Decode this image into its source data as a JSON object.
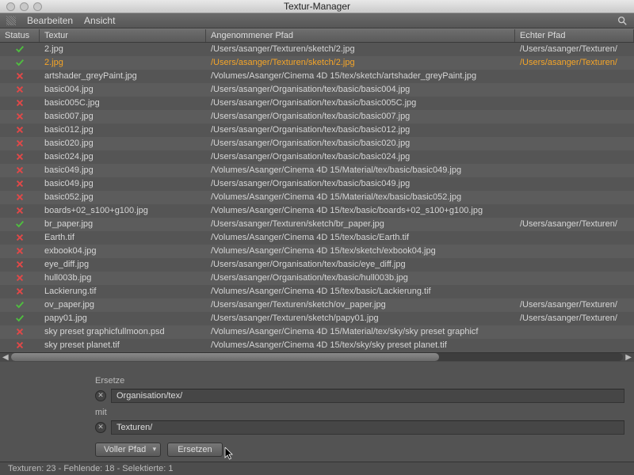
{
  "window": {
    "title": "Textur-Manager"
  },
  "menubar": {
    "edit": "Bearbeiten",
    "view": "Ansicht"
  },
  "columns": {
    "status": "Status",
    "texture": "Textur",
    "assumed": "Angenommener Pfad",
    "real": "Echter Pfad"
  },
  "rows": [
    {
      "status": "ok",
      "texture": "2.jpg",
      "assumed": "/Users/asanger/Texturen/sketch/2.jpg",
      "real": "/Users/asanger/Texturen/",
      "selected": false
    },
    {
      "status": "ok",
      "texture": "2.jpg",
      "assumed": "/Users/asanger/Texturen/sketch/2.jpg",
      "real": "/Users/asanger/Texturen/",
      "selected": true
    },
    {
      "status": "fail",
      "texture": "artshader_greyPaint.jpg",
      "assumed": "/Volumes/Asanger/Cinema 4D 15/tex/sketch/artshader_greyPaint.jpg",
      "real": "",
      "selected": false
    },
    {
      "status": "fail",
      "texture": "basic004.jpg",
      "assumed": "/Users/asanger/Organisation/tex/basic/basic004.jpg",
      "real": "",
      "selected": false
    },
    {
      "status": "fail",
      "texture": "basic005C.jpg",
      "assumed": "/Users/asanger/Organisation/tex/basic/basic005C.jpg",
      "real": "",
      "selected": false
    },
    {
      "status": "fail",
      "texture": "basic007.jpg",
      "assumed": "/Users/asanger/Organisation/tex/basic/basic007.jpg",
      "real": "",
      "selected": false
    },
    {
      "status": "fail",
      "texture": "basic012.jpg",
      "assumed": "/Users/asanger/Organisation/tex/basic/basic012.jpg",
      "real": "",
      "selected": false
    },
    {
      "status": "fail",
      "texture": "basic020.jpg",
      "assumed": "/Users/asanger/Organisation/tex/basic/basic020.jpg",
      "real": "",
      "selected": false
    },
    {
      "status": "fail",
      "texture": "basic024.jpg",
      "assumed": "/Users/asanger/Organisation/tex/basic/basic024.jpg",
      "real": "",
      "selected": false
    },
    {
      "status": "fail",
      "texture": "basic049.jpg",
      "assumed": "/Volumes/Asanger/Cinema 4D 15/Material/tex/basic/basic049.jpg",
      "real": "",
      "selected": false
    },
    {
      "status": "fail",
      "texture": "basic049.jpg",
      "assumed": "/Users/asanger/Organisation/tex/basic/basic049.jpg",
      "real": "",
      "selected": false
    },
    {
      "status": "fail",
      "texture": "basic052.jpg",
      "assumed": "/Volumes/Asanger/Cinema 4D 15/Material/tex/basic/basic052.jpg",
      "real": "",
      "selected": false
    },
    {
      "status": "fail",
      "texture": "boards+02_s100+g100.jpg",
      "assumed": "/Volumes/Asanger/Cinema 4D 15/tex/basic/boards+02_s100+g100.jpg",
      "real": "",
      "selected": false
    },
    {
      "status": "ok",
      "texture": "br_paper.jpg",
      "assumed": "/Users/asanger/Texturen/sketch/br_paper.jpg",
      "real": "/Users/asanger/Texturen/",
      "selected": false
    },
    {
      "status": "fail",
      "texture": "Earth.tif",
      "assumed": "/Volumes/Asanger/Cinema 4D 15/tex/basic/Earth.tif",
      "real": "",
      "selected": false
    },
    {
      "status": "fail",
      "texture": "exbook04.jpg",
      "assumed": "/Volumes/Asanger/Cinema 4D 15/tex/sketch/exbook04.jpg",
      "real": "",
      "selected": false
    },
    {
      "status": "fail",
      "texture": "eye_diff.jpg",
      "assumed": "/Users/asanger/Organisation/tex/basic/eye_diff.jpg",
      "real": "",
      "selected": false
    },
    {
      "status": "fail",
      "texture": "hull003b.jpg",
      "assumed": "/Users/asanger/Organisation/tex/basic/hull003b.jpg",
      "real": "",
      "selected": false
    },
    {
      "status": "fail",
      "texture": "Lackierung.tif",
      "assumed": "/Volumes/Asanger/Cinema 4D 15/tex/basic/Lackierung.tif",
      "real": "",
      "selected": false
    },
    {
      "status": "ok",
      "texture": "ov_paper.jpg",
      "assumed": "/Users/asanger/Texturen/sketch/ov_paper.jpg",
      "real": "/Users/asanger/Texturen/",
      "selected": false
    },
    {
      "status": "ok",
      "texture": "papy01.jpg",
      "assumed": "/Users/asanger/Texturen/sketch/papy01.jpg",
      "real": "/Users/asanger/Texturen/",
      "selected": false
    },
    {
      "status": "fail",
      "texture": "sky preset graphicfullmoon.psd",
      "assumed": "/Volumes/Asanger/Cinema 4D 15/Material/tex/sky/sky preset graphicf",
      "real": "",
      "selected": false
    },
    {
      "status": "fail",
      "texture": "sky preset planet.tif",
      "assumed": "/Volumes/Asanger/Cinema 4D 15/tex/sky/sky preset planet.tif",
      "real": "",
      "selected": false
    }
  ],
  "form": {
    "replace_label": "Ersetze",
    "replace_value": "Organisation/tex/",
    "with_label": "mit",
    "with_value": "Texturen/",
    "mode_label": "Voller Pfad",
    "action_label": "Ersetzen"
  },
  "statusbar": {
    "text": "Texturen: 23 - Fehlende: 18 - Selektierte: 1"
  }
}
